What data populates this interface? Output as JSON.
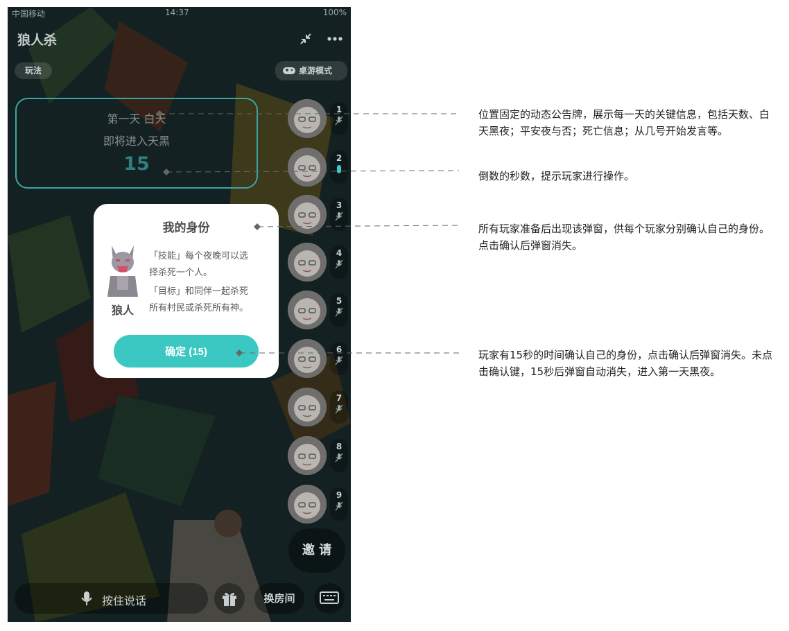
{
  "status_bar": {
    "carrier": "中国移动",
    "time": "14:37",
    "battery": "100%"
  },
  "app": {
    "title": "狼人杀"
  },
  "rules_pill": {
    "label": "玩法"
  },
  "mode_pill": {
    "label": "桌游模式",
    "icon": "gamepad-icon"
  },
  "board": {
    "line1": "第一天 白天",
    "line2": "即将进入天黑",
    "countdown": "15"
  },
  "players": [
    {
      "num": "1",
      "mic": "mic-off-icon"
    },
    {
      "num": "2",
      "mic": "mic-bar-icon"
    },
    {
      "num": "3",
      "mic": "mic-off-icon"
    },
    {
      "num": "4",
      "mic": "mic-off-icon"
    },
    {
      "num": "5",
      "mic": "mic-off-icon"
    },
    {
      "num": "6",
      "mic": "mic-off-icon"
    },
    {
      "num": "7",
      "mic": "mic-off-icon"
    },
    {
      "num": "8",
      "mic": "mic-off-icon"
    },
    {
      "num": "9",
      "mic": "mic-off-icon"
    }
  ],
  "modal": {
    "title": "我的身份",
    "role_name": "狼人",
    "skill_line1": "「技能」每个夜晚可以选",
    "skill_line2": "择杀死一个人。",
    "goal_line1": "「目标」和同伴一起杀死",
    "goal_line2": "所有村民或杀死所有神。",
    "confirm_label": "确定 (15)"
  },
  "invite_label": "邀 请",
  "bottom_bar": {
    "talk_label": "按住说话",
    "switch_room_label": "换房间",
    "gift_icon": "gift-icon",
    "keyboard_icon": "keyboard-icon"
  },
  "annotations": [
    "位置固定的动态公告牌，展示每一天的关键信息，包括天数、白天黑夜；平安夜与否；死亡信息；从几号开始发言等。",
    "倒数的秒数，提示玩家进行操作。",
    "所有玩家准备后出现该弹窗，供每个玩家分别确认自己的身份。点击确认后弹窗消失。",
    "玩家有15秒的时间确认自己的身份，点击确认后弹窗消失。未点击确认键，15秒后弹窗自动消失，进入第一天黑夜。"
  ],
  "colors": {
    "accent": "#3cc8c2",
    "board_border": "#3aa6a3",
    "background_dark": "#1f3336"
  }
}
